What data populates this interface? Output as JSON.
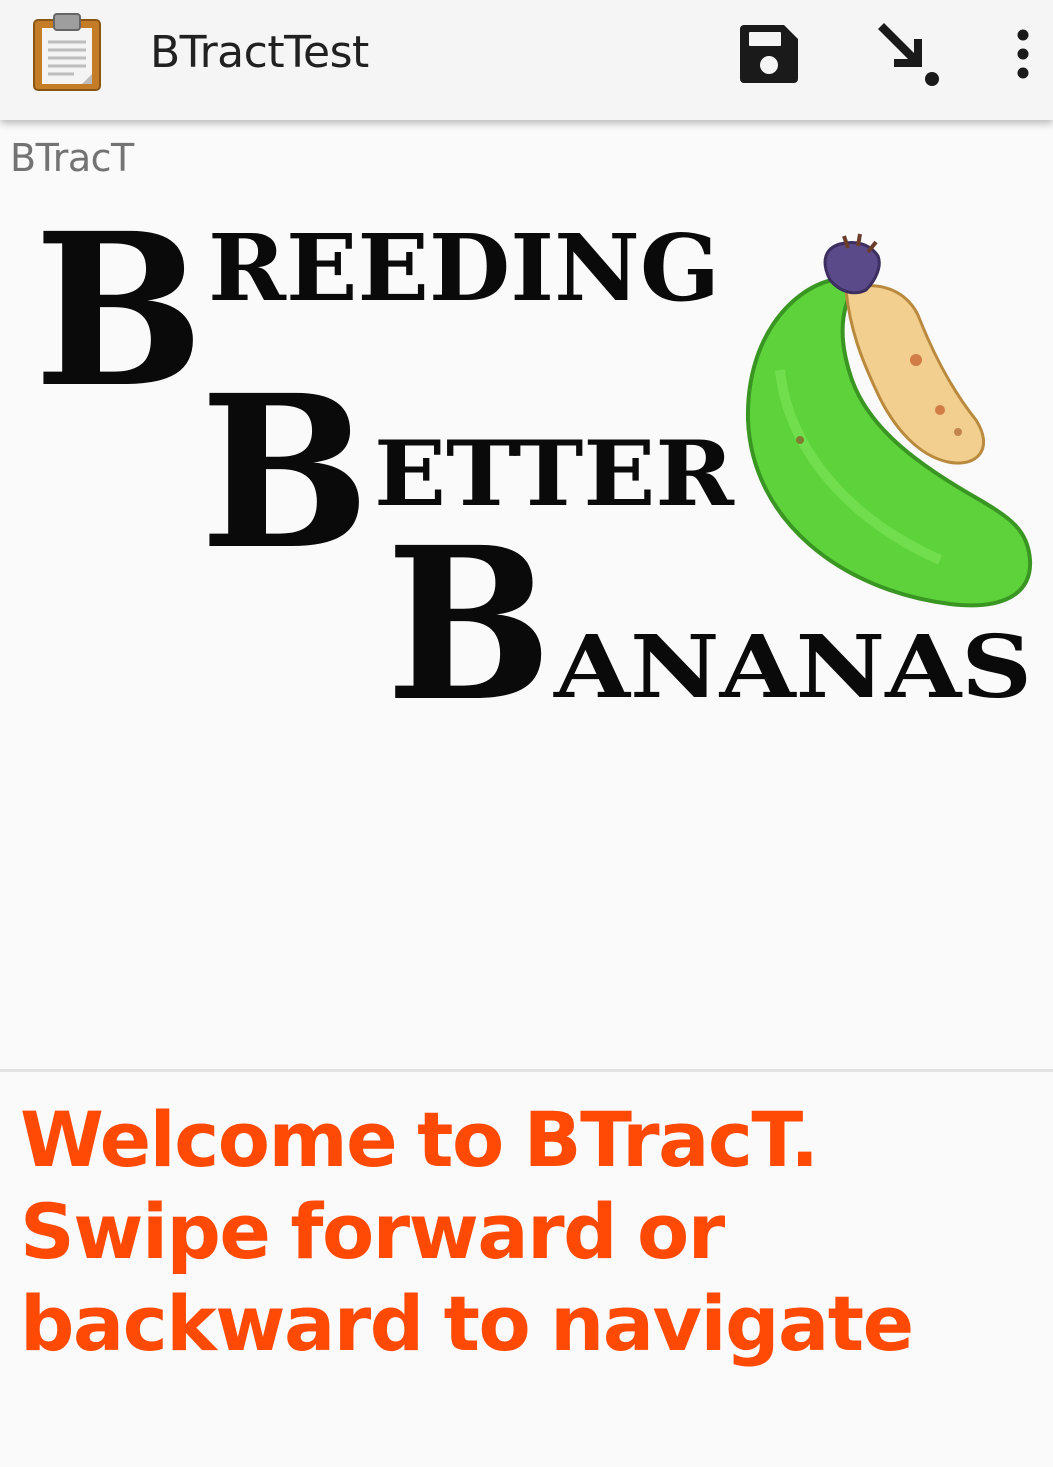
{
  "app_bar": {
    "title": "BTractTest",
    "app_icon": "clipboard-icon",
    "actions": [
      {
        "name": "save",
        "icon": "floppy-disk-icon"
      },
      {
        "name": "export",
        "icon": "arrow-down-right-icon"
      },
      {
        "name": "more",
        "icon": "overflow-menu-icon"
      }
    ]
  },
  "page": {
    "section_label": "BTracT",
    "logo": {
      "line1_initial": "B",
      "line1_rest": "REEDING",
      "line2_initial": "B",
      "line2_rest": "ETTER",
      "line3_initial": "B",
      "line3_rest": "ANANAS"
    },
    "message": "Welcome to BTracT. Swipe forward or backward to navigate"
  },
  "colors": {
    "appbar_bg": "#f5f5f5",
    "page_bg": "#fafafa",
    "message_text": "#ff4a06",
    "title_text": "#212121",
    "label_text": "#737373",
    "banana_green": "#5ed23b",
    "banana_ripe": "#f2cf8e"
  }
}
